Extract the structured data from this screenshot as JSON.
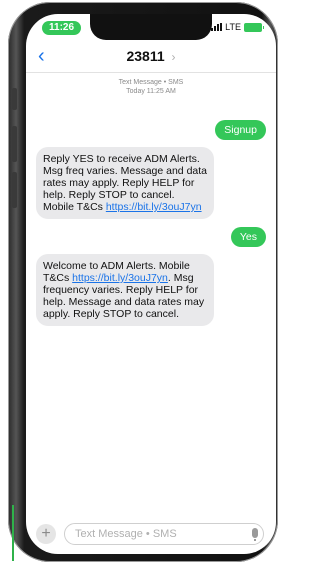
{
  "status": {
    "time": "11:26",
    "network": "LTE"
  },
  "header": {
    "contact": "23811",
    "chevron": "›"
  },
  "thread": {
    "meta_line1": "Text Message • SMS",
    "meta_line2": "Today 11:25 AM"
  },
  "messages": [
    {
      "direction": "outgoing",
      "text": "Signup"
    },
    {
      "direction": "incoming",
      "text": "Reply YES to receive ADM Alerts. Msg freq varies. Message and data rates may apply. Reply HELP for help. Reply STOP to cancel. Mobile T&Cs ",
      "link": "https://bit.ly/3ouJ7yn",
      "text_after": ""
    },
    {
      "direction": "outgoing",
      "text": "Yes"
    },
    {
      "direction": "incoming",
      "text": "Welcome to ADM Alerts. Mobile T&Cs ",
      "link": "https://bit.ly/3ouJ7yn",
      "text_after": ". Msg frequency varies. Reply HELP for help. Message and data rates may apply. Reply STOP to cancel."
    }
  ],
  "composer": {
    "placeholder": "Text Message • SMS",
    "plus": "+"
  },
  "colors": {
    "outgoing_bubble": "#34c759",
    "incoming_bubble": "#e9e9eb",
    "link": "#1a73e8"
  },
  "icons": {
    "back": "chevron-left-icon",
    "mic": "mic-icon",
    "signal": "signal-icon",
    "battery": "battery-icon"
  }
}
